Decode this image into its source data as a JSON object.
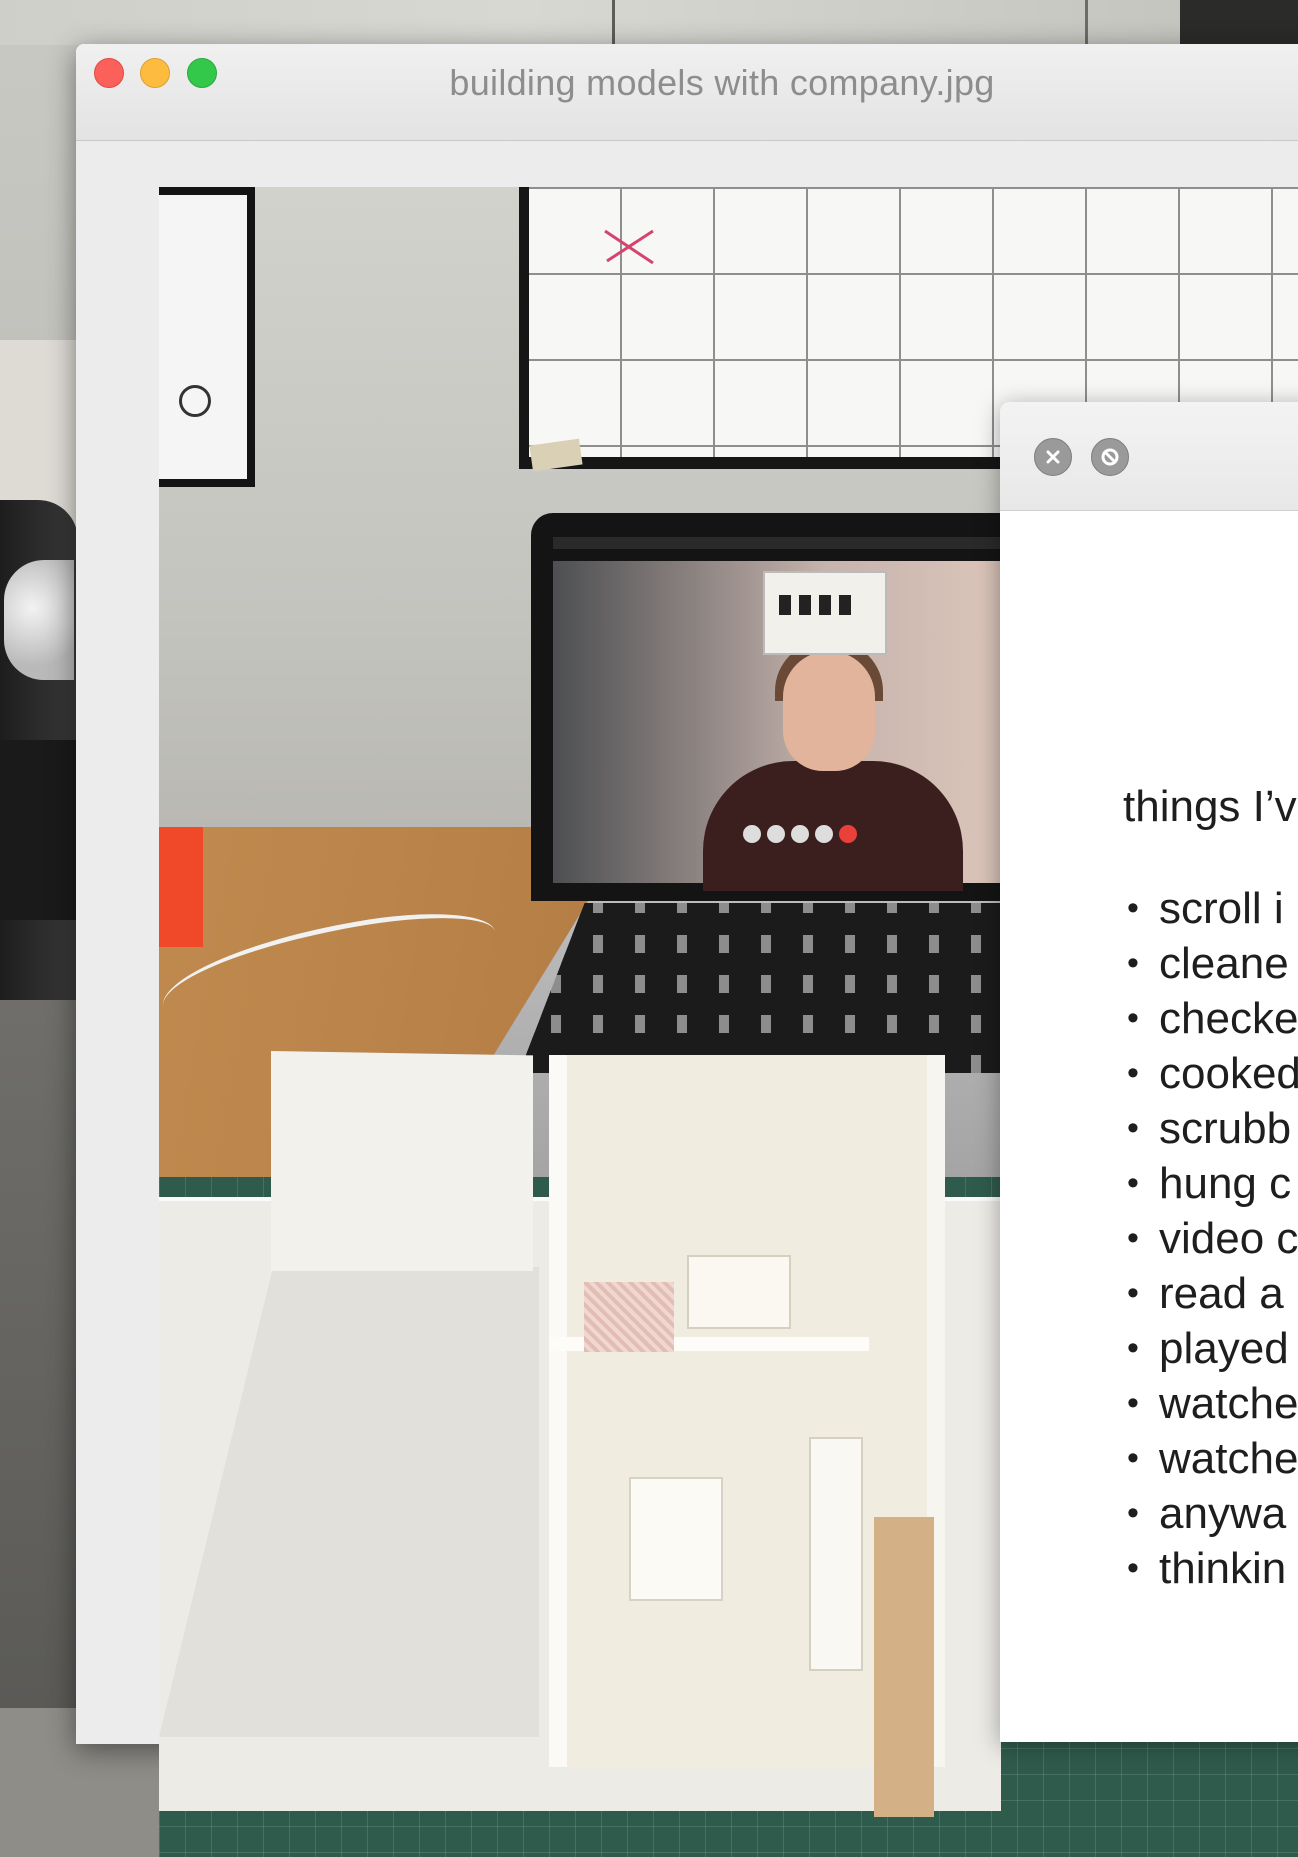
{
  "window": {
    "title": "building models with company.jpg"
  },
  "photo": {
    "alt": "building models with company.jpg"
  },
  "text_window": {
    "heading": "things I’v",
    "items": [
      "scroll i",
      "cleane",
      "checke",
      "cooked",
      "scrubb",
      "hung c",
      "video c",
      "read a",
      "played",
      "watche",
      "watche",
      "anywa",
      "thinkin"
    ]
  },
  "colors": {
    "close": "#fc605b",
    "minimize": "#fdbc40",
    "maximize": "#34c84a"
  }
}
